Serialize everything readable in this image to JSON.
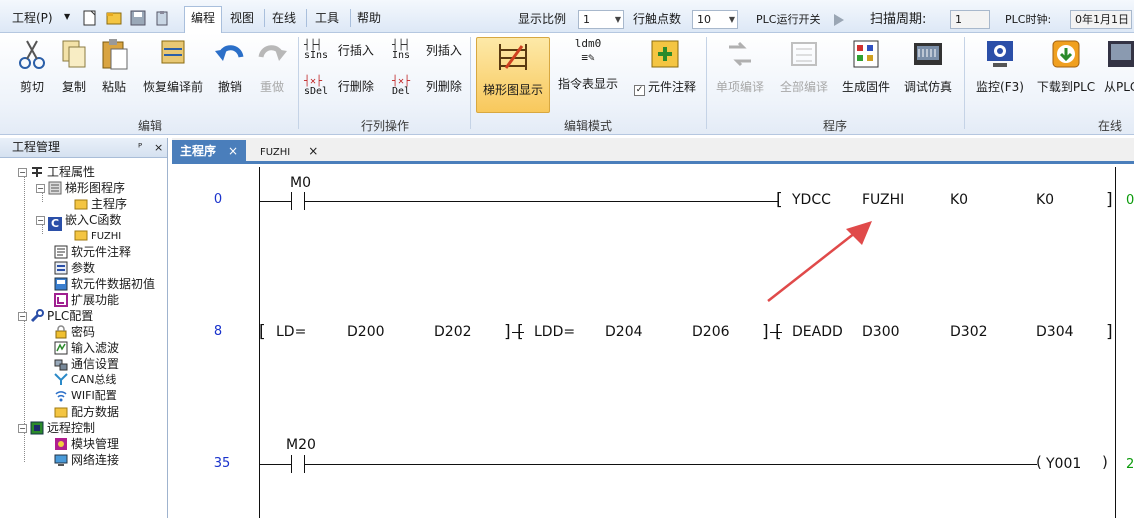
{
  "menubar": {
    "menus": [
      "工程(P)",
      "编程",
      "视图",
      "在线",
      "工具",
      "帮助"
    ],
    "active_menu": "编程",
    "display_ratio_label": "显示比例",
    "display_ratio_value": "1",
    "row_points_label": "行触点数",
    "row_points_value": "10",
    "plc_run_label": "PLC运行开关",
    "scan_period_label": "扫描周期:",
    "scan_period_value": "1",
    "plc_clock_label": "PLC时钟:",
    "plc_clock_value": "0年1月1日"
  },
  "ribbon": {
    "groups": {
      "edit": "编辑",
      "rowcol": "行列操作",
      "editmode": "编辑模式",
      "program": "程序",
      "online": "在线"
    },
    "buttons": {
      "cut": "剪切",
      "copy": "复制",
      "paste": "粘贴",
      "restore": "恢复编译前",
      "undo": "撤销",
      "redo": "重做",
      "row_insert": "行插入",
      "row_delete": "行删除",
      "col_insert": "列插入",
      "col_delete": "列删除",
      "ladder_display": "梯形图显示",
      "instr_display": "指令表显示",
      "comp_comment": "元件注释",
      "single_compile": "单项编译",
      "all_compile": "全部编译",
      "gen_firmware": "生成固件",
      "debug_sim": "调试仿真",
      "monitor": "监控(F3)",
      "download": "下载到PLC",
      "upload": "从PLC"
    },
    "icon_text": {
      "sins": "sIns",
      "sdel": "sDel",
      "ins": "Ins",
      "del": "Del",
      "ldm0": "ldm0"
    }
  },
  "leftpanel": {
    "title": "工程管理",
    "pin": "ᴾ",
    "close": "×",
    "tree": [
      "工程属性",
      "梯形图程序",
      "主程序",
      "嵌入C函数",
      "FUZHI",
      "软元件注释",
      "参数",
      "软元件数据初值",
      "扩展功能",
      "PLC配置",
      "密码",
      "输入滤波",
      "通信设置",
      "CAN总线",
      "WIFI配置",
      "配方数据",
      "远程控制",
      "模块管理",
      "网络连接"
    ]
  },
  "tabs": [
    {
      "label": "主程序",
      "close": "×"
    },
    {
      "label": "FUZHI",
      "close": "×"
    }
  ],
  "ladder": {
    "rungs": [
      {
        "num": "0",
        "contact": "M0",
        "instr": [
          "YDCC",
          "FUZHI",
          "K0",
          "K0"
        ],
        "step": "0"
      },
      {
        "num": "8",
        "instr1": [
          "LD=",
          "D200",
          "D202"
        ],
        "instr2": [
          "LDD=",
          "D204",
          "D206"
        ],
        "instr3": [
          "DEADD",
          "D300",
          "D302",
          "D304"
        ]
      },
      {
        "num": "35",
        "contact": "M20",
        "coil": "Y001",
        "step": "2"
      }
    ]
  },
  "colors": {
    "accent": "#4a7ebb",
    "rung_number": "#1a33cc",
    "step_number": "#0a9a0a",
    "arrow": "#e04a4a"
  }
}
